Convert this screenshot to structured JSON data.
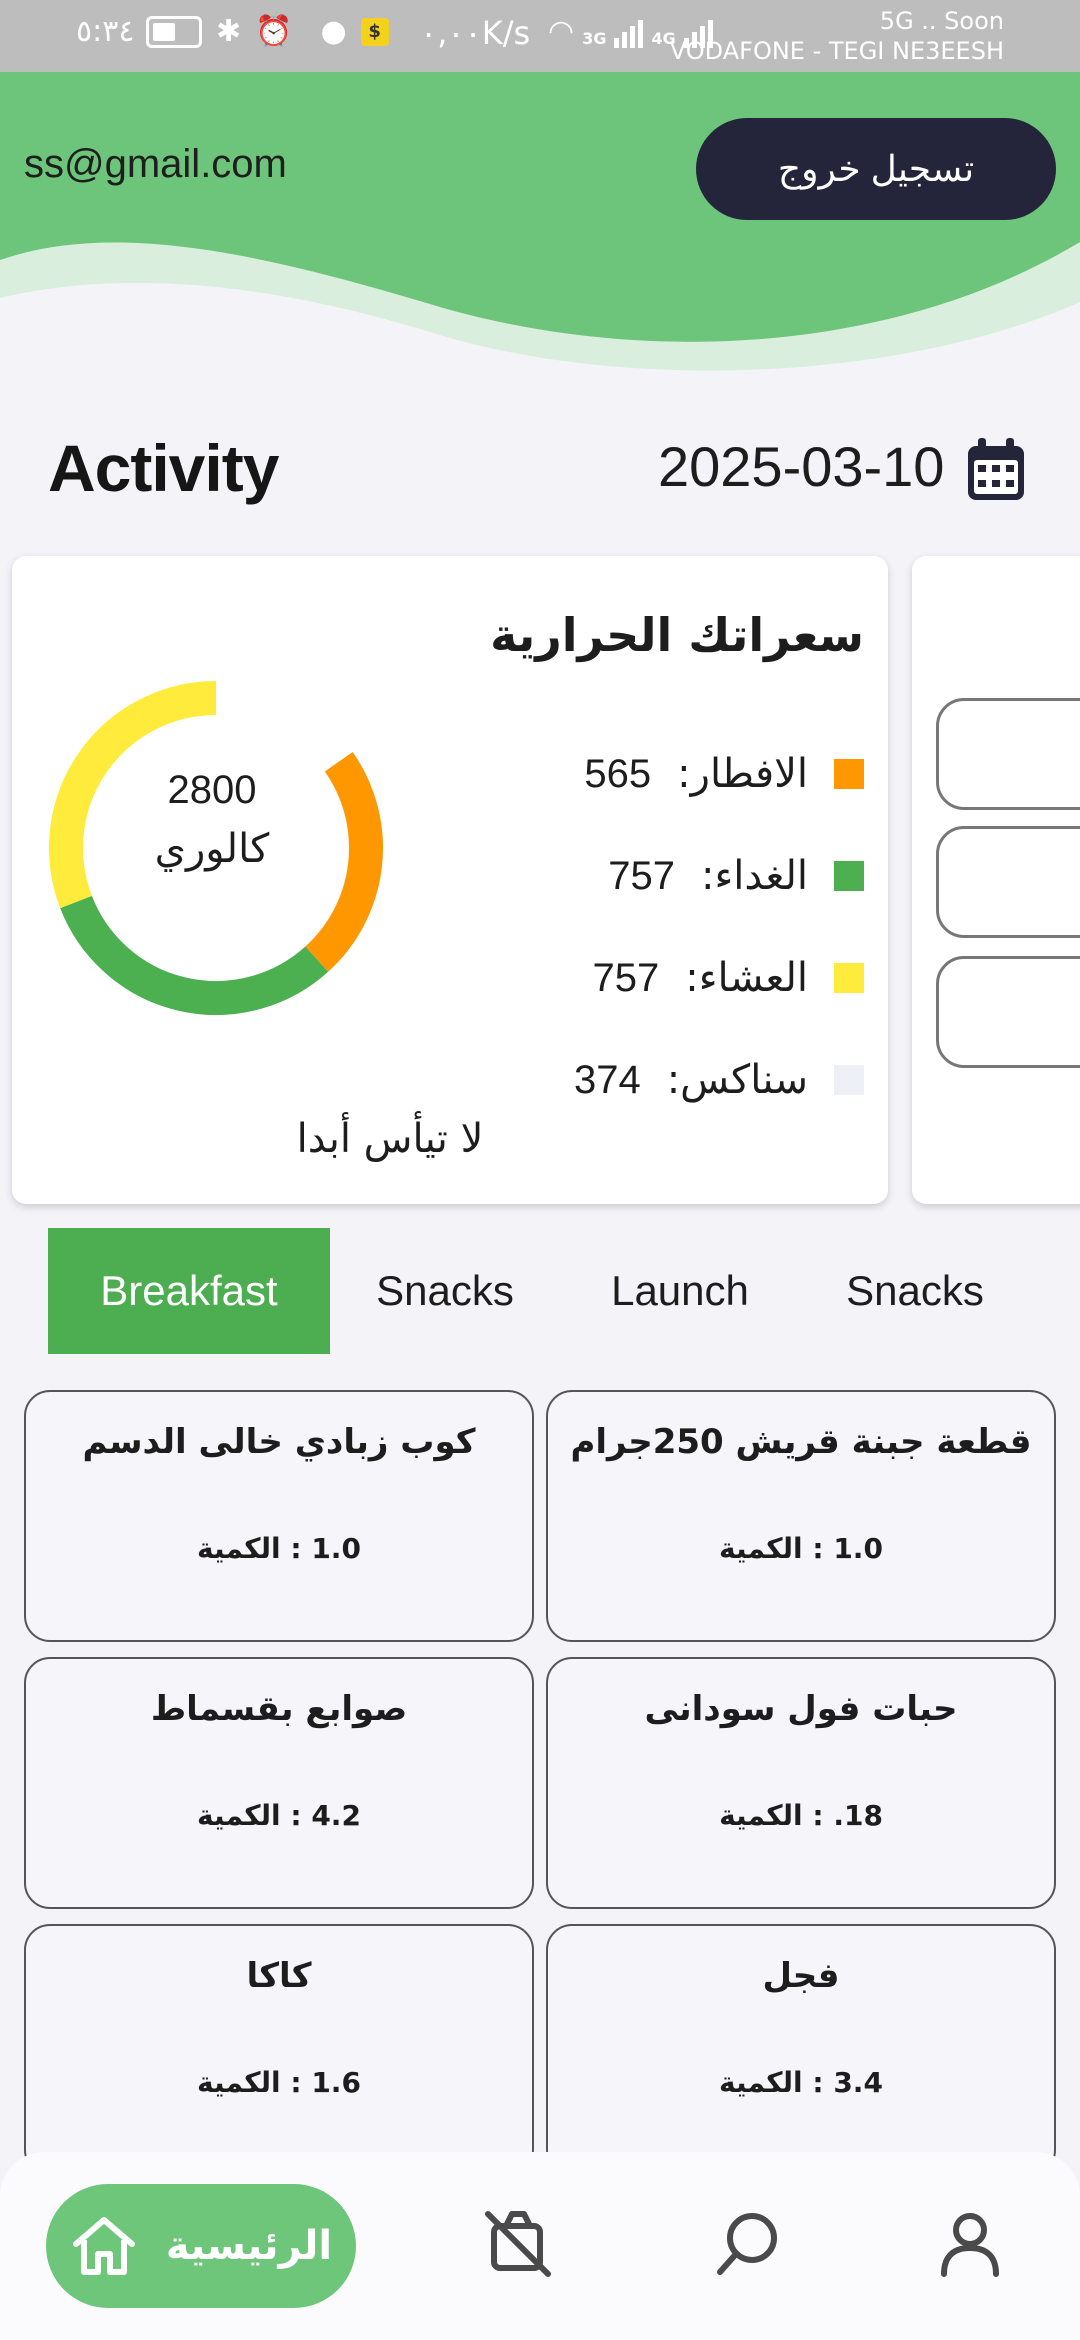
{
  "status_bar": {
    "time": "٥:٣٤",
    "speed": "٠,٠٠K/s",
    "network_5g": "5G .. Soon",
    "carrier": "VODAFONE - TEGI NE3EESH",
    "gen_3g": "3G",
    "gen_4g": "4G",
    "app_badge": "$"
  },
  "header": {
    "email": "ss@gmail.com",
    "logout_label": "تسجيل خروج",
    "colors": {
      "primary": "#6cc57a",
      "wave_light": "#d9eedc",
      "button": "#24243a"
    }
  },
  "activity": {
    "title": "Activity",
    "date": "2025-03-10",
    "calendar_icon": "calendar-icon"
  },
  "calories_card": {
    "title": "سعراتك الحرارية",
    "total": "2800",
    "unit": "كالوري",
    "motto": "لا تيأس أبدا",
    "items": [
      {
        "label": "الافطار:",
        "value": "565",
        "color": "#ff9800"
      },
      {
        "label": "الغداء:",
        "value": "757",
        "color": "#4caf50"
      },
      {
        "label": "العشاء:",
        "value": "757",
        "color": "#ffeb3b"
      },
      {
        "label": "سناكس:",
        "value": "374",
        "color": "#eef0f7"
      }
    ]
  },
  "tabs": [
    {
      "label": "Breakfast",
      "active": true
    },
    {
      "label": "Snacks",
      "active": false
    },
    {
      "label": "Launch",
      "active": false
    },
    {
      "label": "Snacks",
      "active": false
    }
  ],
  "foods": [
    {
      "name": "قطعة جبنة قريش 250جرام",
      "qty": "1.0 : الكمية"
    },
    {
      "name": "كوب زبادي خالى الدسم",
      "qty": "1.0 : الكمية"
    },
    {
      "name": "حبات فول سودانى",
      "qty": "18. : الكمية"
    },
    {
      "name": "صوابع بقسماط",
      "qty": "4.2 : الكمية"
    },
    {
      "name": "فجل",
      "qty": "3.4 : الكمية"
    },
    {
      "name": "كاكا",
      "qty": "1.6 : الكمية"
    }
  ],
  "bottom_nav": {
    "home_label": "الرئيسية",
    "items": [
      "home-icon",
      "no-food-icon",
      "search-icon",
      "profile-icon"
    ]
  }
}
